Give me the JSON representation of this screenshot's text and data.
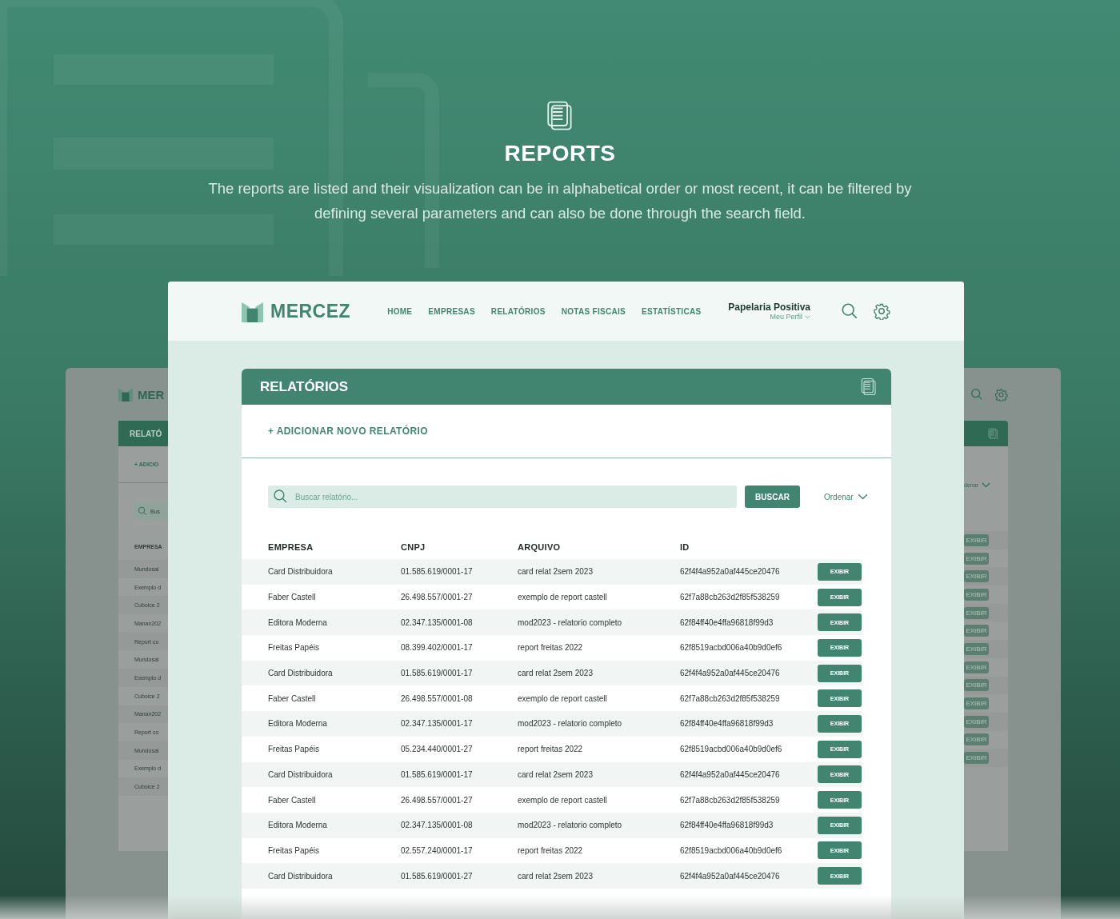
{
  "hero": {
    "title": "REPORTS",
    "description": "The reports are listed and their visualization can be in alphabetical order or most recent, it can be filtered by defining several parameters and can also be done through the search field."
  },
  "back_screen": {
    "left": {
      "logo": "MER",
      "card_title": "RELATÓ",
      "add_link": "+ ADICIO",
      "search_placeholder": "Bus",
      "column_header": "EMPRESA",
      "rows": [
        "Mundosal",
        "Exemplo d",
        "Cuboice 2",
        "Manan202",
        "Report co",
        "Mundosal",
        "Exemplo d",
        "Cuboice 2",
        "Manan202",
        "Report co",
        "Mundosal",
        "Exemplo d",
        "Cuboice 2"
      ]
    },
    "right": {
      "sort": "denar",
      "buttons": [
        "EXIBIR",
        "EXIBIR",
        "EXIBIR",
        "EXIBIR",
        "EXIBIR",
        "EXIBIR",
        "EXIBIR",
        "EXIBIR",
        "EXIBIR",
        "EXIBIR",
        "EXIBIR",
        "EXIBIR",
        "EXIBIR"
      ]
    }
  },
  "app": {
    "logo": "MERCEZ",
    "nav": [
      {
        "label": "HOME"
      },
      {
        "label": "EMPRESAS"
      },
      {
        "label": "RELATÓRIOS"
      },
      {
        "label": "NOTAS FISCAIS"
      },
      {
        "label": "ESTATÍSTICAS"
      }
    ],
    "user": {
      "name": "Papelaria Positiva",
      "profile": "Meu Perfil"
    },
    "card": {
      "title": "RELATÓRIOS",
      "add_link": "+ ADICIONAR NOVO RELATÓRIO",
      "search": {
        "placeholder": "Buscar relatório...",
        "button": "BUSCAR",
        "sort": "Ordenar"
      },
      "table": {
        "columns": [
          "EMPRESA",
          "CNPJ",
          "ARQUIVO",
          "ID"
        ],
        "rows": [
          {
            "empresa": "Card Distribuidora",
            "cnpj": "01.585.619/0001-17",
            "arquivo": "card relat 2sem 2023",
            "id": "62f4f4a952a0af445ce20476",
            "action": "EXIBIR"
          },
          {
            "empresa": "Faber Castell",
            "cnpj": "26.498.557/0001-27",
            "arquivo": "exemplo de report castell",
            "id": "62f7a88cb263d2f85f538259",
            "action": "EXIBIR"
          },
          {
            "empresa": "Editora Moderna",
            "cnpj": "02.347.135/0001-08",
            "arquivo": "mod2023 - relatorio completo",
            "id": "62f84ff40e4ffa96818f99d3",
            "action": "EXIBIR"
          },
          {
            "empresa": "Freitas Papéis",
            "cnpj": "08.399.402/0001-17",
            "arquivo": "report freitas 2022",
            "id": "62f8519acbd006a40b9d0ef6",
            "action": "EXIBIR"
          },
          {
            "empresa": "Card Distribuidora",
            "cnpj": "01.585.619/0001-17",
            "arquivo": "card relat 2sem 2023",
            "id": "62f4f4a952a0af445ce20476",
            "action": "EXIBIR"
          },
          {
            "empresa": "Faber Castell",
            "cnpj": "26.498.557/0001-08",
            "arquivo": "exemplo de report castell",
            "id": "62f7a88cb263d2f85f538259",
            "action": "EXIBIR"
          },
          {
            "empresa": "Editora Moderna",
            "cnpj": "02.347.135/0001-17",
            "arquivo": "mod2023 - relatorio completo",
            "id": "62f84ff40e4ffa96818f99d3",
            "action": "EXIBIR"
          },
          {
            "empresa": "Freitas Papéis",
            "cnpj": "05.234.440/0001-27",
            "arquivo": "report freitas 2022",
            "id": "62f8519acbd006a40b9d0ef6",
            "action": "EXIBIR"
          },
          {
            "empresa": "Card Distribuidora",
            "cnpj": "01.585.619/0001-17",
            "arquivo": "card relat 2sem 2023",
            "id": "62f4f4a952a0af445ce20476",
            "action": "EXIBIR"
          },
          {
            "empresa": "Faber Castell",
            "cnpj": "26.498.557/0001-27",
            "arquivo": "exemplo de report castell",
            "id": "62f7a88cb263d2f85f538259",
            "action": "EXIBIR"
          },
          {
            "empresa": "Editora Moderna",
            "cnpj": "02.347.135/0001-08",
            "arquivo": "mod2023 - relatorio completo",
            "id": "62f84ff40e4ffa96818f99d3",
            "action": "EXIBIR"
          },
          {
            "empresa": "Freitas Papéis",
            "cnpj": "02.557.240/0001-17",
            "arquivo": "report freitas 2022",
            "id": "62f8519acbd006a40b9d0ef6",
            "action": "EXIBIR"
          },
          {
            "empresa": "Card Distribuidora",
            "cnpj": "01.585.619/0001-27",
            "arquivo": "card relat 2sem 2023",
            "id": "62f4f4a952a0af445ce20476",
            "action": "EXIBIR"
          }
        ]
      }
    }
  }
}
